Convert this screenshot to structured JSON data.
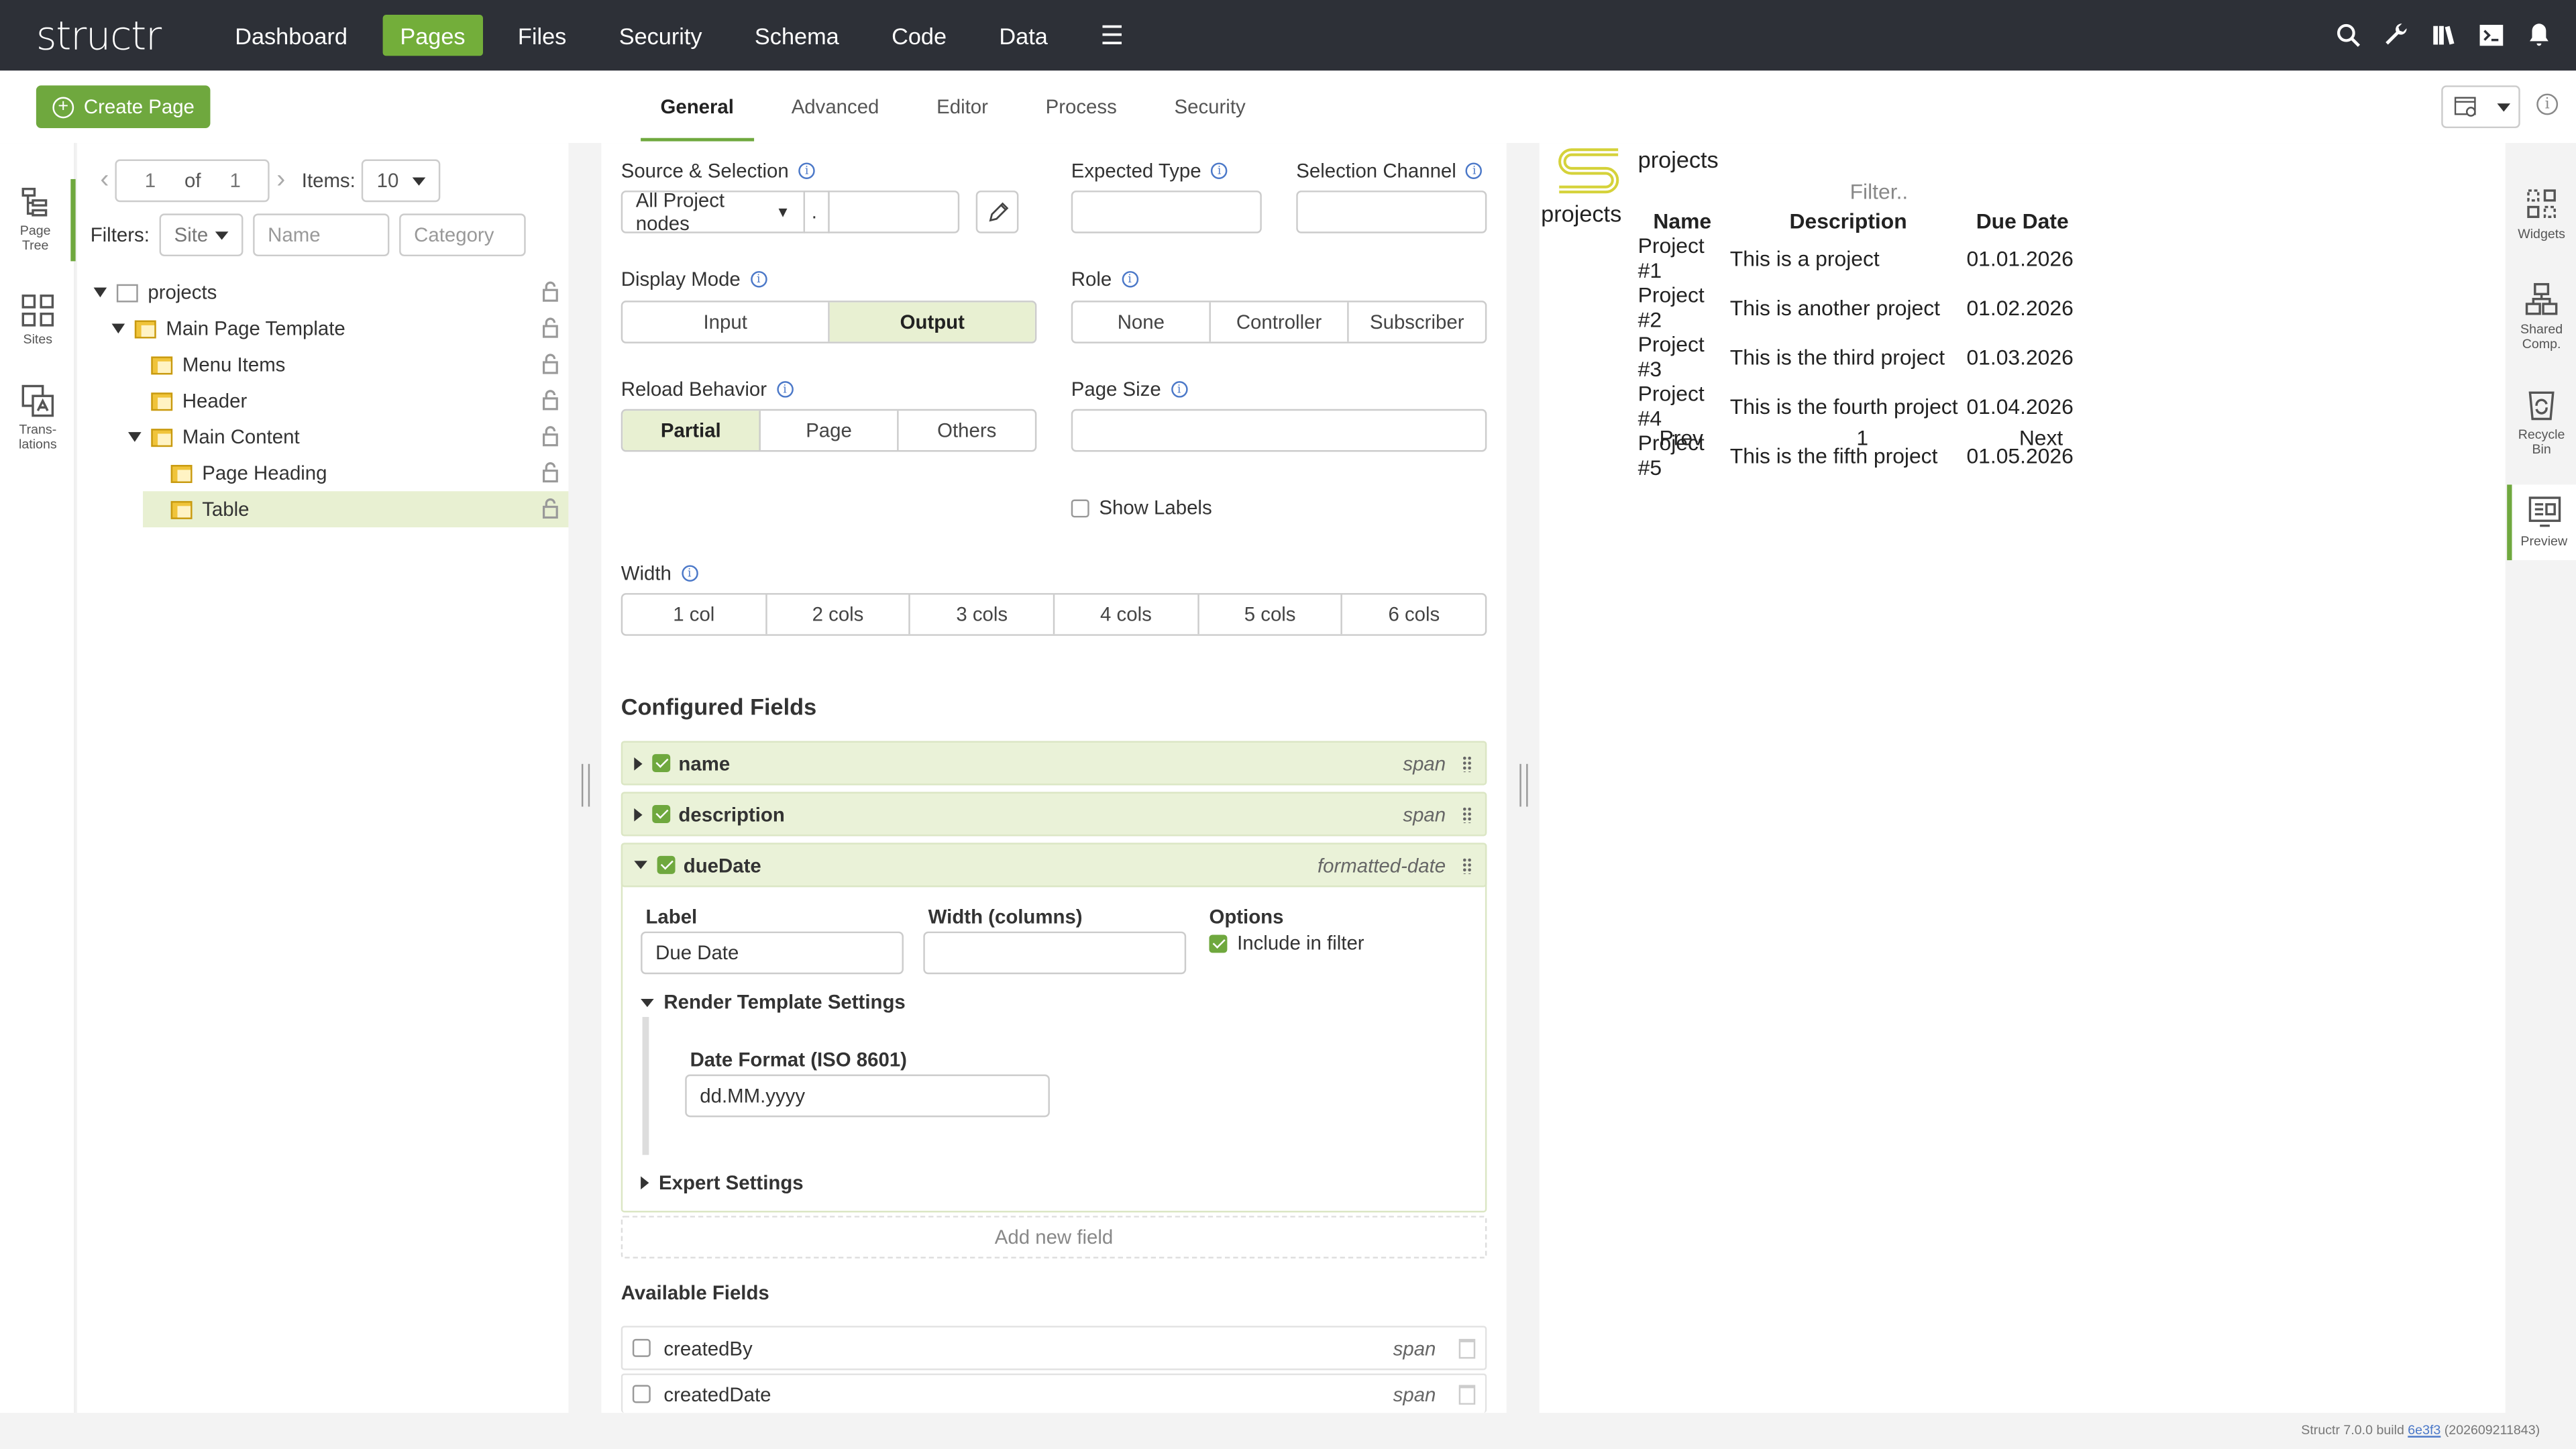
{
  "app": {
    "logo": "structr"
  },
  "nav": {
    "items": [
      "Dashboard",
      "Pages",
      "Files",
      "Security",
      "Schema",
      "Code",
      "Data"
    ],
    "more_icon": "hamburger-icon"
  },
  "toolbar": {
    "create_page": "Create Page"
  },
  "tabs": [
    "General",
    "Advanced",
    "Editor",
    "Process",
    "Security"
  ],
  "left_rail": [
    "Page Tree",
    "Sites",
    "Trans-lations"
  ],
  "pager": {
    "page": "1",
    "of_label": "of",
    "total": "1",
    "items_label": "Items:",
    "items_value": "10"
  },
  "filters": {
    "label": "Filters:",
    "site": "Site",
    "name_placeholder": "Name",
    "category_placeholder": "Category"
  },
  "tree": [
    {
      "label": "projects",
      "type": "page"
    },
    {
      "label": "Main Page Template",
      "type": "template"
    },
    {
      "label": "Menu Items",
      "type": "template"
    },
    {
      "label": "Header",
      "type": "template"
    },
    {
      "label": "Main Content",
      "type": "template"
    },
    {
      "label": "Page Heading",
      "type": "template"
    },
    {
      "label": "Table",
      "type": "template",
      "selected": true
    }
  ],
  "form": {
    "source_label": "Source & Selection",
    "source_value": "All Project nodes",
    "source_dot": ".",
    "expected_type_label": "Expected Type",
    "selection_channel_label": "Selection Channel",
    "display_mode_label": "Display Mode",
    "display_mode_options": [
      "Input",
      "Output"
    ],
    "display_mode_selected": "Output",
    "role_label": "Role",
    "role_options": [
      "None",
      "Controller",
      "Subscriber"
    ],
    "reload_label": "Reload Behavior",
    "reload_options": [
      "Partial",
      "Page",
      "Others"
    ],
    "reload_selected": "Partial",
    "page_size_label": "Page Size",
    "show_labels": "Show Labels",
    "width_label": "Width",
    "width_options": [
      "1 col",
      "2 cols",
      "3 cols",
      "4 cols",
      "5 cols",
      "6 cols"
    ]
  },
  "configured": {
    "heading": "Configured Fields",
    "fields": [
      {
        "name": "name",
        "tag": "span"
      },
      {
        "name": "description",
        "tag": "span"
      },
      {
        "name": "dueDate",
        "tag": "formatted-date"
      }
    ],
    "detail": {
      "label_title": "Label",
      "label_value": "Due Date",
      "width_title": "Width (columns)",
      "options_title": "Options",
      "include_filter": "Include in filter",
      "render_settings": "Render Template Settings",
      "date_format_label": "Date Format (ISO 8601)",
      "date_format_value": "dd.MM.yyyy",
      "expert_settings": "Expert Settings"
    },
    "add_new": "Add new field"
  },
  "available": {
    "heading": "Available Fields",
    "fields": [
      {
        "name": "createdBy",
        "tag": "span"
      },
      {
        "name": "createdDate",
        "tag": "span"
      }
    ]
  },
  "preview": {
    "logo_caption": "projects",
    "title": "projects",
    "filter_placeholder": "Filter..",
    "columns": [
      "Name",
      "Description",
      "Due Date"
    ],
    "rows": [
      [
        "Project #1",
        "This is a project",
        "01.01.2026"
      ],
      [
        "Project #2",
        "This is another project",
        "01.02.2026"
      ],
      [
        "Project #3",
        "This is the third project",
        "01.03.2026"
      ],
      [
        "Project #4",
        "This is the fourth project",
        "01.04.2026"
      ],
      [
        "Project #5",
        "This is the fifth project",
        "01.05.2026"
      ]
    ],
    "prev": "Prev",
    "page": "1",
    "next": "Next"
  },
  "right_rail": [
    "Widgets",
    "Shared Comp.",
    "Recycle Bin",
    "Preview"
  ],
  "footer": {
    "prefix": "Structr 7.0.0 build ",
    "build": "6e3f3",
    "suffix": " (202609211843)"
  },
  "colors": {
    "accent": "#6fa83e",
    "topbar": "#2d3037",
    "selected_bg": "#e8f0d2",
    "info": "#4b78c8"
  }
}
